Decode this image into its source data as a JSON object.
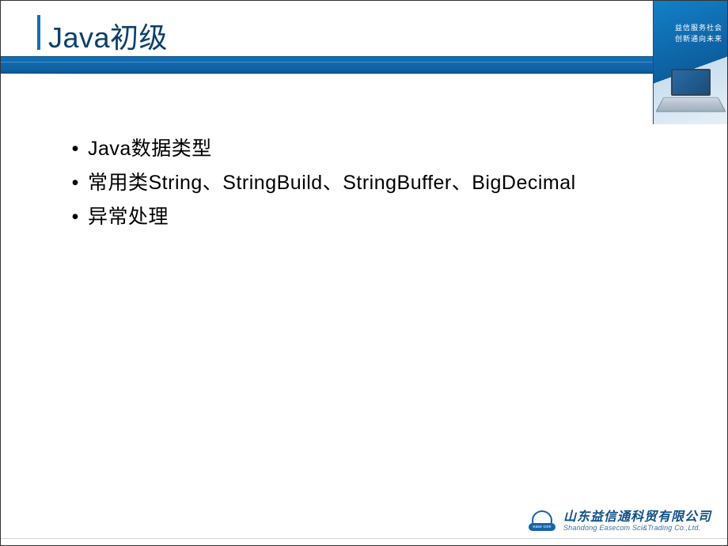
{
  "header": {
    "title": "Java初级",
    "slogan_line1": "益信服务社会",
    "slogan_line2": "创新通向未来"
  },
  "bullets": [
    "Java数据类型",
    "常用类String、StringBuild、StringBuffer、BigDecimal",
    "异常处理"
  ],
  "footer": {
    "logo_text": "ease com",
    "company_cn": "山东益信通科贸有限公司",
    "company_en": "Shandong Easecom Sci&Trading Co.,Ltd."
  }
}
